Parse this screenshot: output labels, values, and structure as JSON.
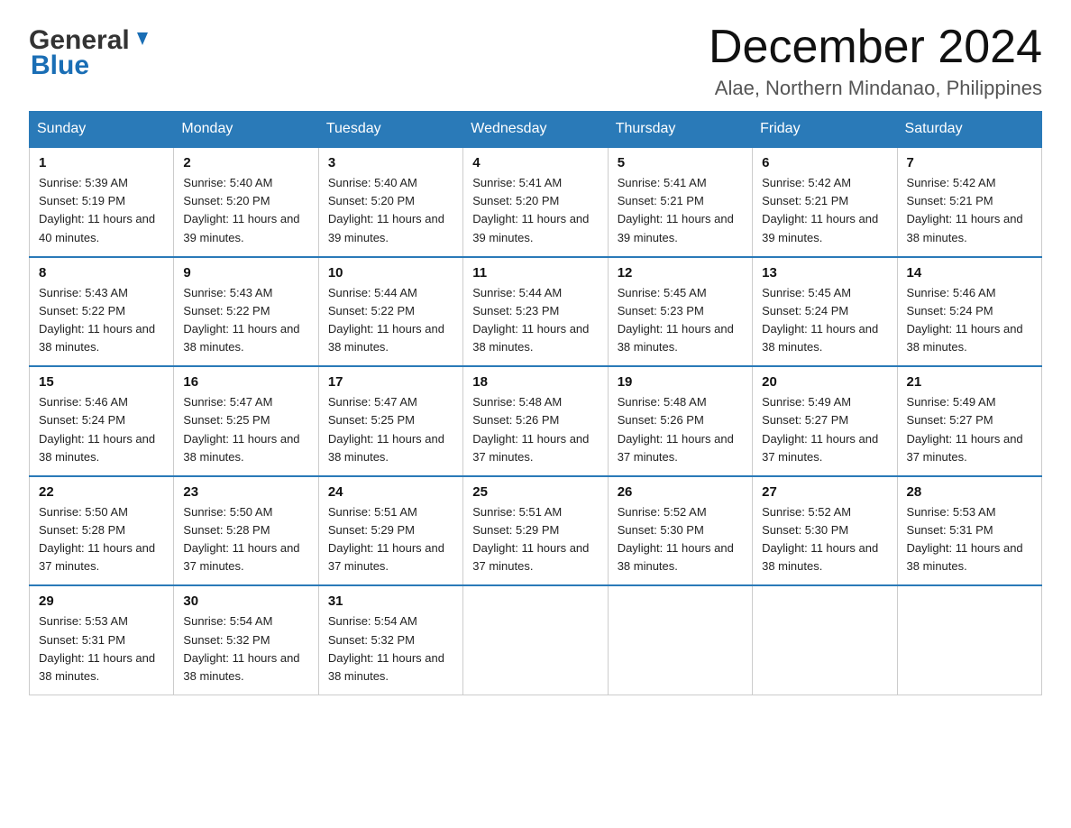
{
  "logo": {
    "general": "General",
    "blue": "Blue"
  },
  "title": {
    "month_year": "December 2024",
    "location": "Alae, Northern Mindanao, Philippines"
  },
  "weekdays": [
    "Sunday",
    "Monday",
    "Tuesday",
    "Wednesday",
    "Thursday",
    "Friday",
    "Saturday"
  ],
  "weeks": [
    [
      {
        "day": "1",
        "sunrise": "5:39 AM",
        "sunset": "5:19 PM",
        "daylight": "11 hours and 40 minutes."
      },
      {
        "day": "2",
        "sunrise": "5:40 AM",
        "sunset": "5:20 PM",
        "daylight": "11 hours and 39 minutes."
      },
      {
        "day": "3",
        "sunrise": "5:40 AM",
        "sunset": "5:20 PM",
        "daylight": "11 hours and 39 minutes."
      },
      {
        "day": "4",
        "sunrise": "5:41 AM",
        "sunset": "5:20 PM",
        "daylight": "11 hours and 39 minutes."
      },
      {
        "day": "5",
        "sunrise": "5:41 AM",
        "sunset": "5:21 PM",
        "daylight": "11 hours and 39 minutes."
      },
      {
        "day": "6",
        "sunrise": "5:42 AM",
        "sunset": "5:21 PM",
        "daylight": "11 hours and 39 minutes."
      },
      {
        "day": "7",
        "sunrise": "5:42 AM",
        "sunset": "5:21 PM",
        "daylight": "11 hours and 38 minutes."
      }
    ],
    [
      {
        "day": "8",
        "sunrise": "5:43 AM",
        "sunset": "5:22 PM",
        "daylight": "11 hours and 38 minutes."
      },
      {
        "day": "9",
        "sunrise": "5:43 AM",
        "sunset": "5:22 PM",
        "daylight": "11 hours and 38 minutes."
      },
      {
        "day": "10",
        "sunrise": "5:44 AM",
        "sunset": "5:22 PM",
        "daylight": "11 hours and 38 minutes."
      },
      {
        "day": "11",
        "sunrise": "5:44 AM",
        "sunset": "5:23 PM",
        "daylight": "11 hours and 38 minutes."
      },
      {
        "day": "12",
        "sunrise": "5:45 AM",
        "sunset": "5:23 PM",
        "daylight": "11 hours and 38 minutes."
      },
      {
        "day": "13",
        "sunrise": "5:45 AM",
        "sunset": "5:24 PM",
        "daylight": "11 hours and 38 minutes."
      },
      {
        "day": "14",
        "sunrise": "5:46 AM",
        "sunset": "5:24 PM",
        "daylight": "11 hours and 38 minutes."
      }
    ],
    [
      {
        "day": "15",
        "sunrise": "5:46 AM",
        "sunset": "5:24 PM",
        "daylight": "11 hours and 38 minutes."
      },
      {
        "day": "16",
        "sunrise": "5:47 AM",
        "sunset": "5:25 PM",
        "daylight": "11 hours and 38 minutes."
      },
      {
        "day": "17",
        "sunrise": "5:47 AM",
        "sunset": "5:25 PM",
        "daylight": "11 hours and 38 minutes."
      },
      {
        "day": "18",
        "sunrise": "5:48 AM",
        "sunset": "5:26 PM",
        "daylight": "11 hours and 37 minutes."
      },
      {
        "day": "19",
        "sunrise": "5:48 AM",
        "sunset": "5:26 PM",
        "daylight": "11 hours and 37 minutes."
      },
      {
        "day": "20",
        "sunrise": "5:49 AM",
        "sunset": "5:27 PM",
        "daylight": "11 hours and 37 minutes."
      },
      {
        "day": "21",
        "sunrise": "5:49 AM",
        "sunset": "5:27 PM",
        "daylight": "11 hours and 37 minutes."
      }
    ],
    [
      {
        "day": "22",
        "sunrise": "5:50 AM",
        "sunset": "5:28 PM",
        "daylight": "11 hours and 37 minutes."
      },
      {
        "day": "23",
        "sunrise": "5:50 AM",
        "sunset": "5:28 PM",
        "daylight": "11 hours and 37 minutes."
      },
      {
        "day": "24",
        "sunrise": "5:51 AM",
        "sunset": "5:29 PM",
        "daylight": "11 hours and 37 minutes."
      },
      {
        "day": "25",
        "sunrise": "5:51 AM",
        "sunset": "5:29 PM",
        "daylight": "11 hours and 37 minutes."
      },
      {
        "day": "26",
        "sunrise": "5:52 AM",
        "sunset": "5:30 PM",
        "daylight": "11 hours and 38 minutes."
      },
      {
        "day": "27",
        "sunrise": "5:52 AM",
        "sunset": "5:30 PM",
        "daylight": "11 hours and 38 minutes."
      },
      {
        "day": "28",
        "sunrise": "5:53 AM",
        "sunset": "5:31 PM",
        "daylight": "11 hours and 38 minutes."
      }
    ],
    [
      {
        "day": "29",
        "sunrise": "5:53 AM",
        "sunset": "5:31 PM",
        "daylight": "11 hours and 38 minutes."
      },
      {
        "day": "30",
        "sunrise": "5:54 AM",
        "sunset": "5:32 PM",
        "daylight": "11 hours and 38 minutes."
      },
      {
        "day": "31",
        "sunrise": "5:54 AM",
        "sunset": "5:32 PM",
        "daylight": "11 hours and 38 minutes."
      },
      null,
      null,
      null,
      null
    ]
  ],
  "labels": {
    "sunrise": "Sunrise:",
    "sunset": "Sunset:",
    "daylight": "Daylight:"
  }
}
